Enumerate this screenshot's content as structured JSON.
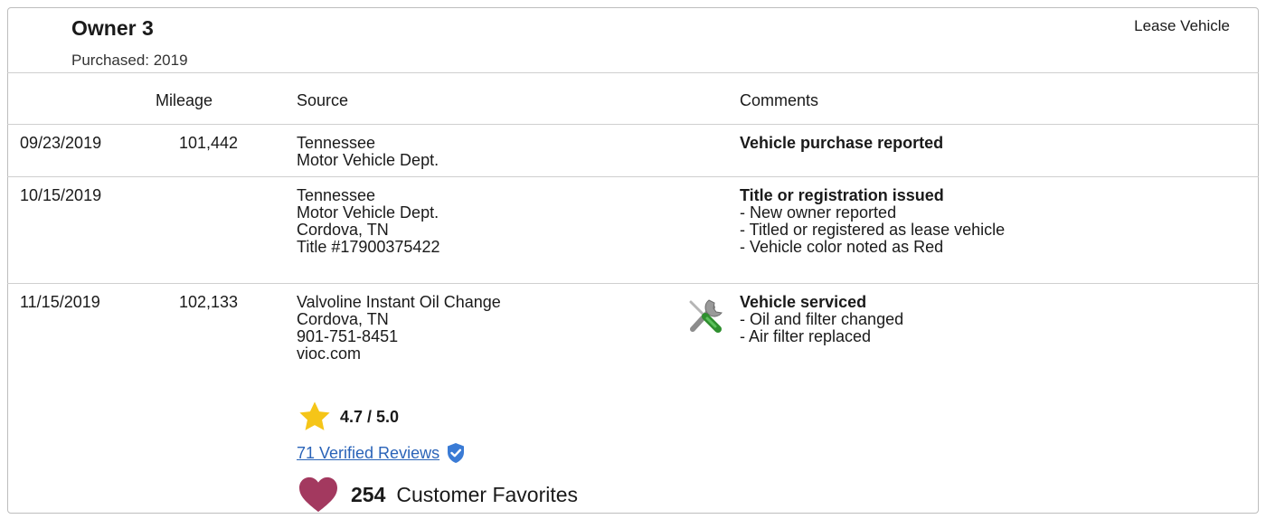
{
  "owner": {
    "title": "Owner 3",
    "purchased": "Purchased: 2019",
    "lease_label": "Lease Vehicle"
  },
  "columns": {
    "mileage": "Mileage",
    "source": "Source",
    "comments": "Comments"
  },
  "rows": [
    {
      "date": "09/23/2019",
      "mileage": "101,442",
      "source": [
        "Tennessee",
        "Motor Vehicle Dept."
      ],
      "comment_head": "Vehicle purchase reported",
      "comment_lines": []
    },
    {
      "date": "10/15/2019",
      "mileage": "",
      "source": [
        "Tennessee",
        "Motor Vehicle Dept.",
        "Cordova, TN",
        "Title #17900375422"
      ],
      "comment_head": "Title or registration issued",
      "comment_lines": [
        "- New owner reported",
        "- Titled or registered as lease vehicle",
        "- Vehicle color noted as Red"
      ]
    },
    {
      "date": "11/15/2019",
      "mileage": "102,133",
      "source": [
        "Valvoline Instant Oil Change",
        "Cordova, TN",
        "901-751-8451",
        "vioc.com"
      ],
      "comment_head": "Vehicle serviced",
      "comment_lines": [
        "- Oil and filter changed",
        "- Air filter replaced"
      ],
      "icon": "wrench-screwdriver-icon",
      "rating": "4.7 / 5.0",
      "reviews_link": "71 Verified Reviews",
      "favorites_count": "254",
      "favorites_label": "Customer Favorites"
    }
  ],
  "colors": {
    "star": "#f5c518",
    "verified": "#3a7bd5",
    "heart": "#a3395f",
    "link": "#2a63b8"
  }
}
